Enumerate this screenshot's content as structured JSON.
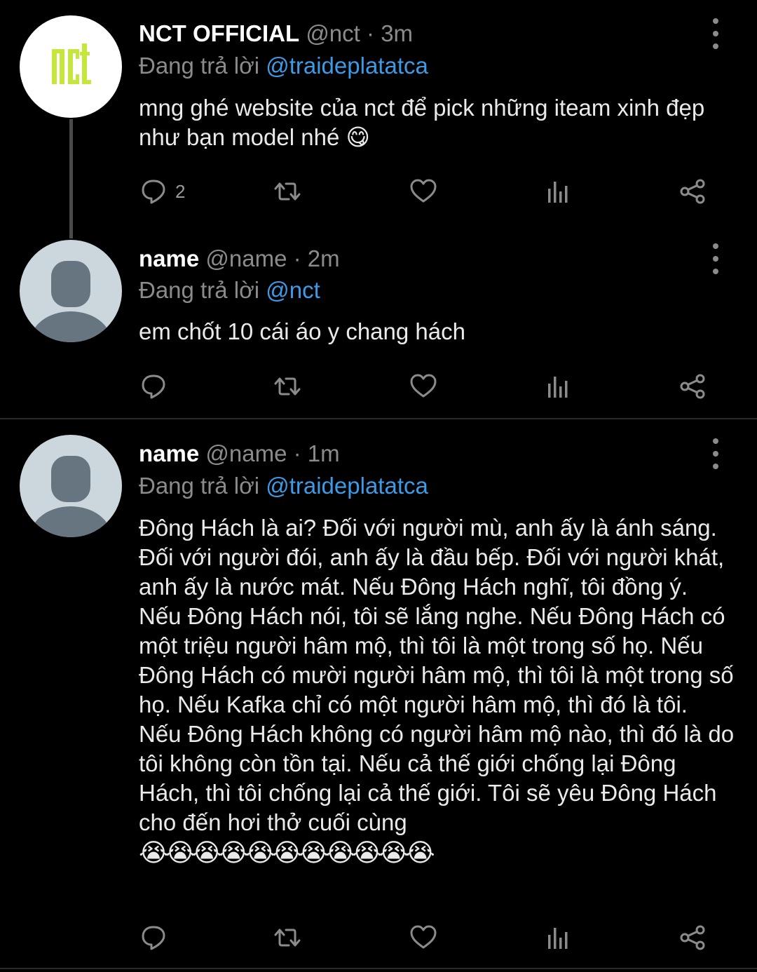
{
  "tweets": [
    {
      "display_name": "NCT OFFICIAL",
      "handle": "@nct",
      "separator": "·",
      "time": "3m",
      "replying_prefix": "Đang trả lời",
      "replying_to": "@traideplatatca",
      "text": "mng ghé website của nct để pick những iteam xinh đẹp như bạn model nhé 😋",
      "reply_count": "2",
      "avatar_logo": "nct"
    },
    {
      "display_name": "name",
      "handle": "@name",
      "separator": "·",
      "time": "2m",
      "replying_prefix": "Đang trả lời",
      "replying_to": "@nct",
      "text": "em chốt 10 cái áo y chang hách",
      "reply_count": ""
    },
    {
      "display_name": "name",
      "handle": "@name",
      "separator": "·",
      "time": "1m",
      "replying_prefix": "Đang trả lời",
      "replying_to": "@traideplatatca",
      "text": "Đông Hách là ai? Đối với người mù, anh ấy là ánh sáng. Đối với người đói, anh ấy là đầu bếp. Đối với người khát, anh ấy là nước mát. Nếu Đông Hách nghĩ, tôi đồng ý. Nếu Đông Hách nói, tôi sẽ lắng nghe. Nếu Đông Hách có một triệu người hâm mộ, thì tôi là một trong số họ. Nếu Đông Hách có mười người hâm mộ, thì tôi là một trong số họ. Nếu Kafka chỉ có một người hâm mộ, thì đó là tôi. Nếu Đông Hách không có người hâm mộ nào, thì đó là do tôi không còn tồn tại. Nếu cả thế giới chống lại Đông Hách, thì tôi chống lại cả thế giới. Tôi sẽ yêu Đông Hách cho đến hơi thở cuối cùng",
      "emoji_line": "😭😭😭😭😭😭😭😭😭😭😭",
      "reply_count": ""
    }
  ],
  "icons": [
    "reply-icon",
    "retweet-icon",
    "like-icon",
    "analytics-icon",
    "share-icon",
    "more-options-icon"
  ],
  "colors": {
    "background": "#000000",
    "text_primary": "#ffffff",
    "text_secondary": "#8b8b8b",
    "link": "#3d9ae6",
    "nct_logo": "#c5e63a"
  }
}
